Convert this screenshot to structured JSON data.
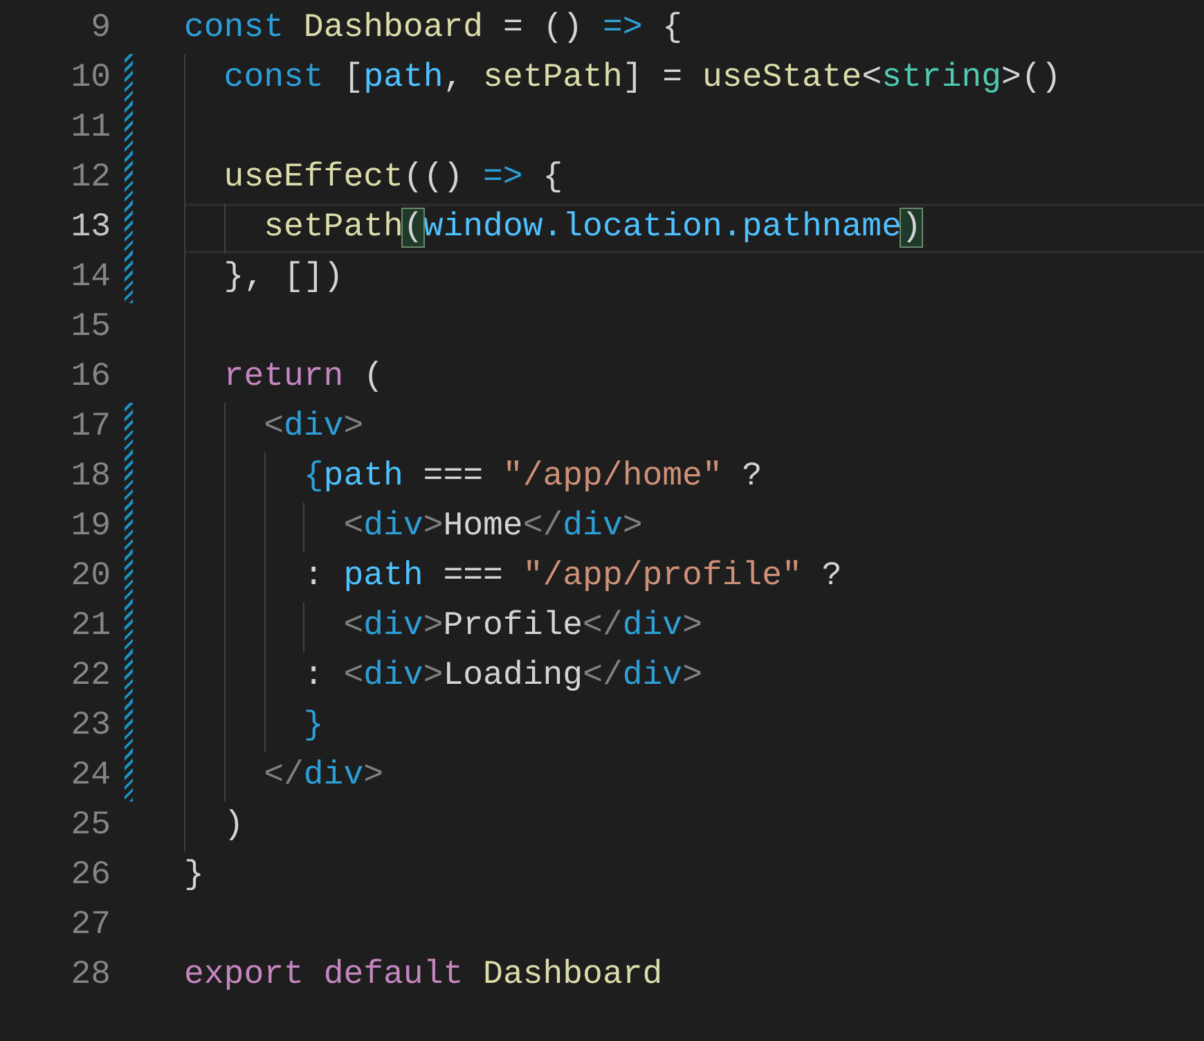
{
  "editor": {
    "lines": [
      {
        "number": "9",
        "modified": false,
        "current": false,
        "tokens": [
          {
            "text": "const",
            "kind": "keyword"
          },
          {
            "text": " Dashboard",
            "kind": "function"
          },
          {
            "text": " = () ",
            "kind": "punct"
          },
          {
            "text": "=>",
            "kind": "keyword"
          },
          {
            "text": " {",
            "kind": "punct"
          }
        ],
        "children": [
          {
            "number": "10",
            "modified": true,
            "current": false,
            "tokens": [
              {
                "text": "const",
                "kind": "keyword"
              },
              {
                "text": " [",
                "kind": "punct"
              },
              {
                "text": "path",
                "kind": "variable"
              },
              {
                "text": ", ",
                "kind": "punct"
              },
              {
                "text": "setPath",
                "kind": "function"
              },
              {
                "text": "] = ",
                "kind": "punct"
              },
              {
                "text": "useState",
                "kind": "function"
              },
              {
                "text": "<",
                "kind": "punct"
              },
              {
                "text": "string",
                "kind": "type"
              },
              {
                "text": ">()",
                "kind": "punct"
              }
            ]
          },
          {
            "number": "11",
            "modified": true,
            "current": false
          },
          {
            "number": "12",
            "modified": true,
            "current": false,
            "tokens": [
              {
                "text": "useEffect",
                "kind": "function"
              },
              {
                "text": "(() ",
                "kind": "punct"
              },
              {
                "text": "=>",
                "kind": "keyword"
              },
              {
                "text": " {",
                "kind": "punct"
              }
            ],
            "children": [
              {
                "number": "13",
                "modified": true,
                "current": true,
                "tokens": [
                  {
                    "text": "setPath",
                    "kind": "function"
                  },
                  {
                    "text": "(",
                    "kind": "matched"
                  },
                  {
                    "text": "window.location.pathname",
                    "kind": "variable"
                  },
                  {
                    "text": ")",
                    "kind": "matched"
                  }
                ]
              }
            ]
          },
          {
            "number": "14",
            "modified": true,
            "current": false,
            "tokens": [
              {
                "text": "}, [])",
                "kind": "punct"
              }
            ]
          },
          {
            "number": "15",
            "modified": false,
            "current": false
          },
          {
            "number": "16",
            "modified": false,
            "current": false,
            "tokens": [
              {
                "text": "return",
                "kind": "control"
              },
              {
                "text": " (",
                "kind": "punct"
              }
            ],
            "children": [
              {
                "number": "17",
                "modified": true,
                "current": false,
                "tokens": [
                  {
                    "text": "<",
                    "kind": "tagpunct"
                  },
                  {
                    "text": "div",
                    "kind": "tag"
                  },
                  {
                    "text": ">",
                    "kind": "tagpunct"
                  }
                ],
                "children": [
                  {
                    "number": "18",
                    "modified": true,
                    "current": false,
                    "tokens": [
                      {
                        "text": "{",
                        "kind": "jsxbrace"
                      },
                      {
                        "text": "path",
                        "kind": "variable"
                      },
                      {
                        "text": " === ",
                        "kind": "punct"
                      },
                      {
                        "text": "\"/app/home\"",
                        "kind": "string"
                      },
                      {
                        "text": " ?",
                        "kind": "punct"
                      }
                    ],
                    "children": [
                      {
                        "number": "19",
                        "modified": true,
                        "current": false,
                        "tokens": [
                          {
                            "text": "<",
                            "kind": "tagpunct"
                          },
                          {
                            "text": "div",
                            "kind": "tag"
                          },
                          {
                            "text": ">",
                            "kind": "tagpunct"
                          },
                          {
                            "text": "Home",
                            "kind": "text"
                          },
                          {
                            "text": "</",
                            "kind": "tagpunct"
                          },
                          {
                            "text": "div",
                            "kind": "tag"
                          },
                          {
                            "text": ">",
                            "kind": "tagpunct"
                          }
                        ]
                      }
                    ]
                  },
                  {
                    "number": "20",
                    "modified": true,
                    "current": false,
                    "tokens": [
                      {
                        "text": ": ",
                        "kind": "punct"
                      },
                      {
                        "text": "path",
                        "kind": "variable"
                      },
                      {
                        "text": " === ",
                        "kind": "punct"
                      },
                      {
                        "text": "\"/app/profile\"",
                        "kind": "string"
                      },
                      {
                        "text": " ?",
                        "kind": "punct"
                      }
                    ],
                    "children": [
                      {
                        "number": "21",
                        "modified": true,
                        "current": false,
                        "tokens": [
                          {
                            "text": "<",
                            "kind": "tagpunct"
                          },
                          {
                            "text": "div",
                            "kind": "tag"
                          },
                          {
                            "text": ">",
                            "kind": "tagpunct"
                          },
                          {
                            "text": "Profile",
                            "kind": "text"
                          },
                          {
                            "text": "</",
                            "kind": "tagpunct"
                          },
                          {
                            "text": "div",
                            "kind": "tag"
                          },
                          {
                            "text": ">",
                            "kind": "tagpunct"
                          }
                        ]
                      }
                    ]
                  },
                  {
                    "number": "22",
                    "modified": true,
                    "current": false,
                    "tokens": [
                      {
                        "text": ": ",
                        "kind": "punct"
                      },
                      {
                        "text": "<",
                        "kind": "tagpunct"
                      },
                      {
                        "text": "div",
                        "kind": "tag"
                      },
                      {
                        "text": ">",
                        "kind": "tagpunct"
                      },
                      {
                        "text": "Loading",
                        "kind": "text"
                      },
                      {
                        "text": "</",
                        "kind": "tagpunct"
                      },
                      {
                        "text": "div",
                        "kind": "tag"
                      },
                      {
                        "text": ">",
                        "kind": "tagpunct"
                      }
                    ]
                  },
                  {
                    "number": "23",
                    "modified": true,
                    "current": false,
                    "tokens": [
                      {
                        "text": "}",
                        "kind": "jsxbrace"
                      }
                    ]
                  }
                ]
              },
              {
                "number": "24",
                "modified": true,
                "current": false,
                "tokens": [
                  {
                    "text": "</",
                    "kind": "tagpunct"
                  },
                  {
                    "text": "div",
                    "kind": "tag"
                  },
                  {
                    "text": ">",
                    "kind": "tagpunct"
                  }
                ]
              }
            ]
          },
          {
            "number": "25",
            "modified": false,
            "current": false,
            "tokens": [
              {
                "text": ")",
                "kind": "punct"
              }
            ]
          }
        ]
      },
      {
        "number": "26",
        "modified": false,
        "current": false,
        "tokens": [
          {
            "text": "}",
            "kind": "punct"
          }
        ]
      },
      {
        "number": "27",
        "modified": false,
        "current": false
      },
      {
        "number": "28",
        "modified": false,
        "current": false,
        "tokens": [
          {
            "text": "export",
            "kind": "control"
          },
          {
            "text": " default",
            "kind": "control"
          },
          {
            "text": " Dashboard",
            "kind": "function"
          }
        ]
      }
    ]
  }
}
